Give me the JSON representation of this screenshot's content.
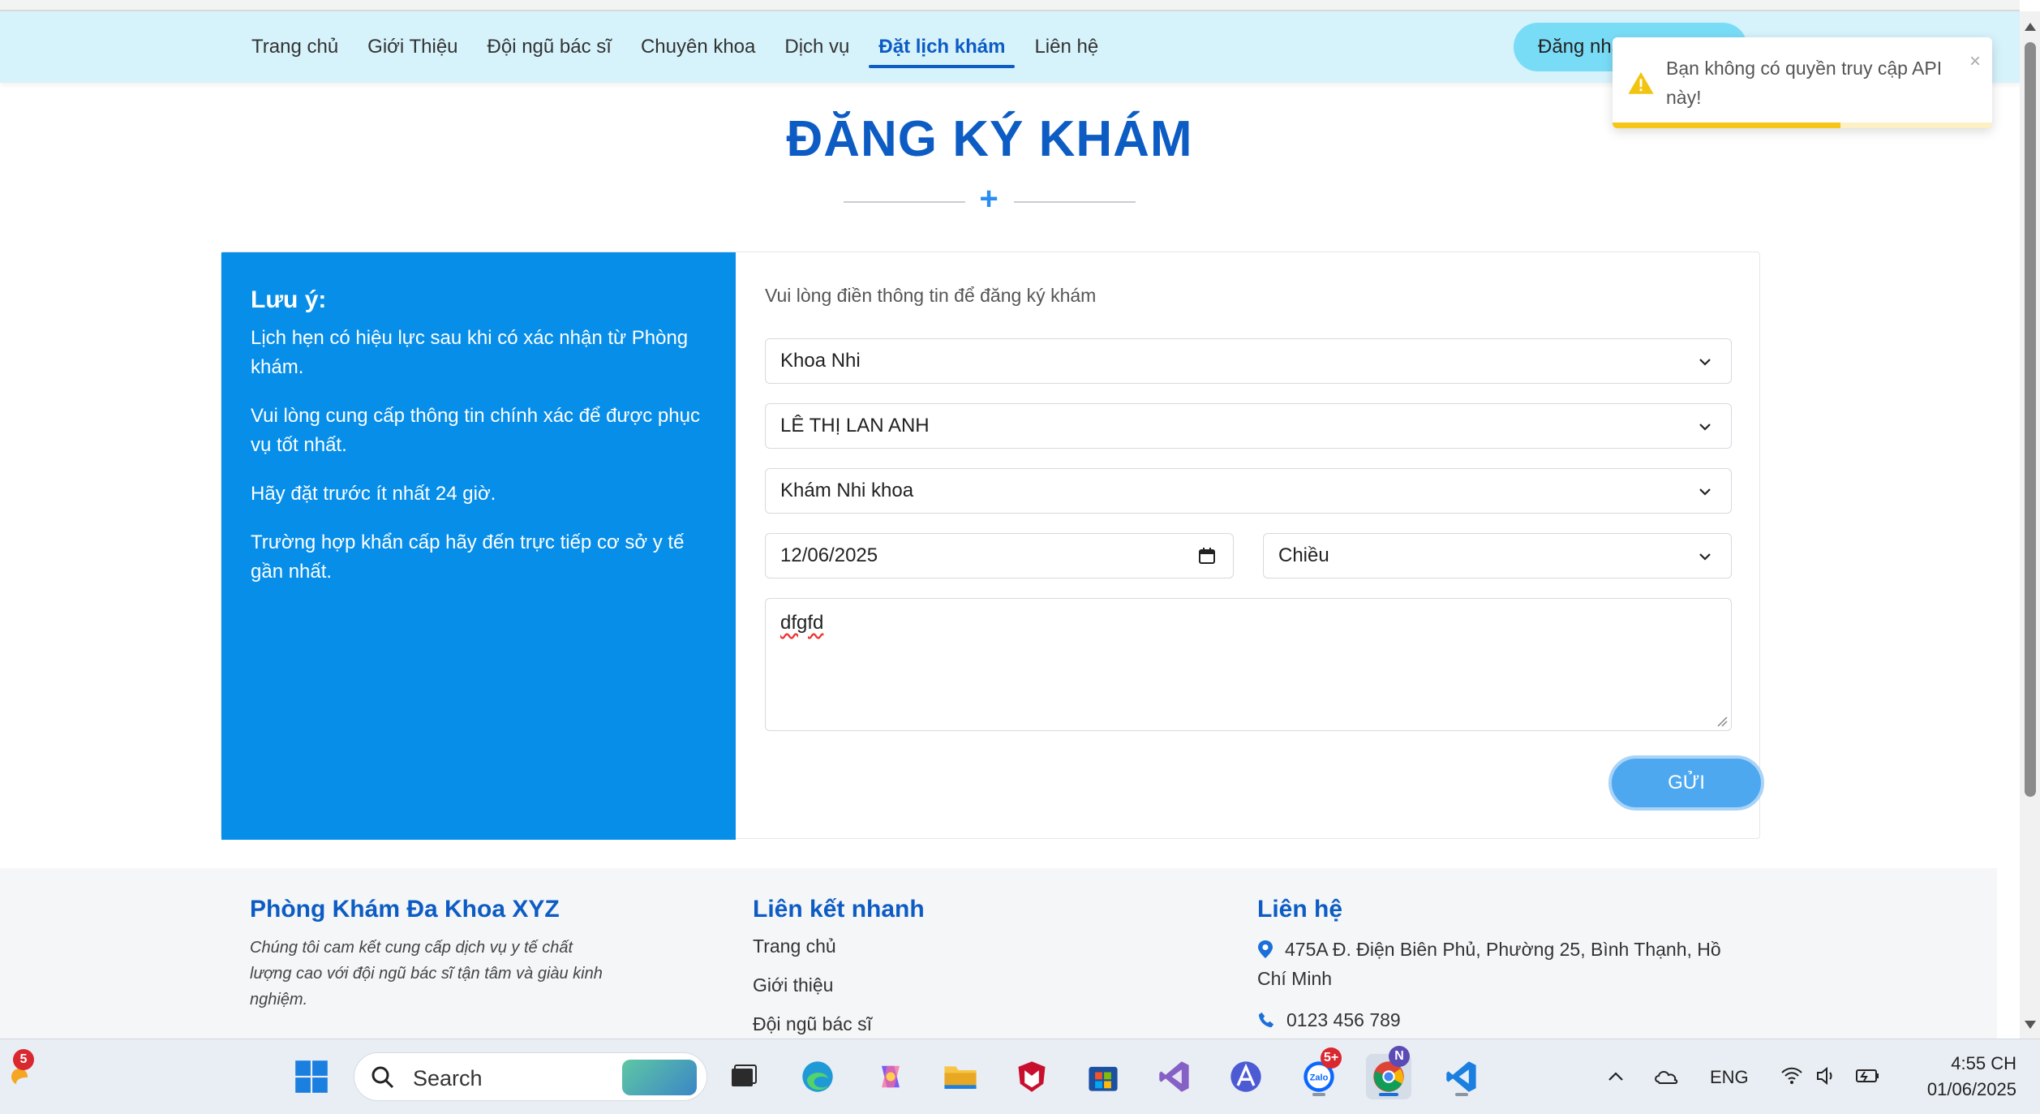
{
  "nav": {
    "items": [
      "Trang chủ",
      "Giới Thiệu",
      "Đội ngũ bác sĩ",
      "Chuyên khoa",
      "Dịch vụ",
      "Đặt lịch khám",
      "Liên hệ"
    ],
    "active_index": 5,
    "login_label": "Đăng nhập"
  },
  "toast": {
    "message": "Bạn không có quyền truy cập API này!",
    "close": "×",
    "progress": 0.6,
    "icon": "warning-icon"
  },
  "page": {
    "title": "ĐĂNG KÝ KHÁM"
  },
  "note": {
    "title": "Lưu ý:",
    "items": [
      "Lịch hẹn có hiệu lực sau khi có xác nhận từ Phòng khám.",
      "Vui lòng cung cấp thông tin chính xác để được phục vụ tốt nhất.",
      "Hãy đặt trước ít nhất 24 giờ.",
      "Trường hợp khẩn cấp hãy đến trực tiếp cơ sở y tế gần nhất."
    ]
  },
  "form": {
    "hint": "Vui lòng điền thông tin để đăng ký khám",
    "department": "Khoa Nhi",
    "doctor": "LÊ THỊ LAN ANH",
    "service": "Khám Nhi khoa",
    "date": "12/06/2025",
    "session": "Chiều",
    "note_text": "dfgfd",
    "submit_label": "GỬI"
  },
  "footer": {
    "clinic_title": "Phòng Khám Đa Khoa XYZ",
    "clinic_desc": "Chúng tôi cam kết cung cấp dịch vụ y tế chất lượng cao với đội ngũ bác sĩ tận tâm và giàu kinh nghiệm.",
    "links_title": "Liên kết nhanh",
    "links": [
      "Trang chủ",
      "Giới thiệu",
      "Đội ngũ bác sĩ"
    ],
    "contact_title": "Liên hệ",
    "address": "475A Đ. Điện Biên Phủ, Phường 25, Bình Thạnh, Hồ Chí Minh",
    "phone": "0123 456 789"
  },
  "taskbar": {
    "search_placeholder": "Search",
    "weather_badge": "5",
    "zalo_badge": "5+",
    "zalo_label": "Zalo",
    "chrome_profile": "N",
    "language": "ENG",
    "time": "4:55 CH",
    "date": "01/06/2025",
    "accent": "#0d5cc4"
  }
}
